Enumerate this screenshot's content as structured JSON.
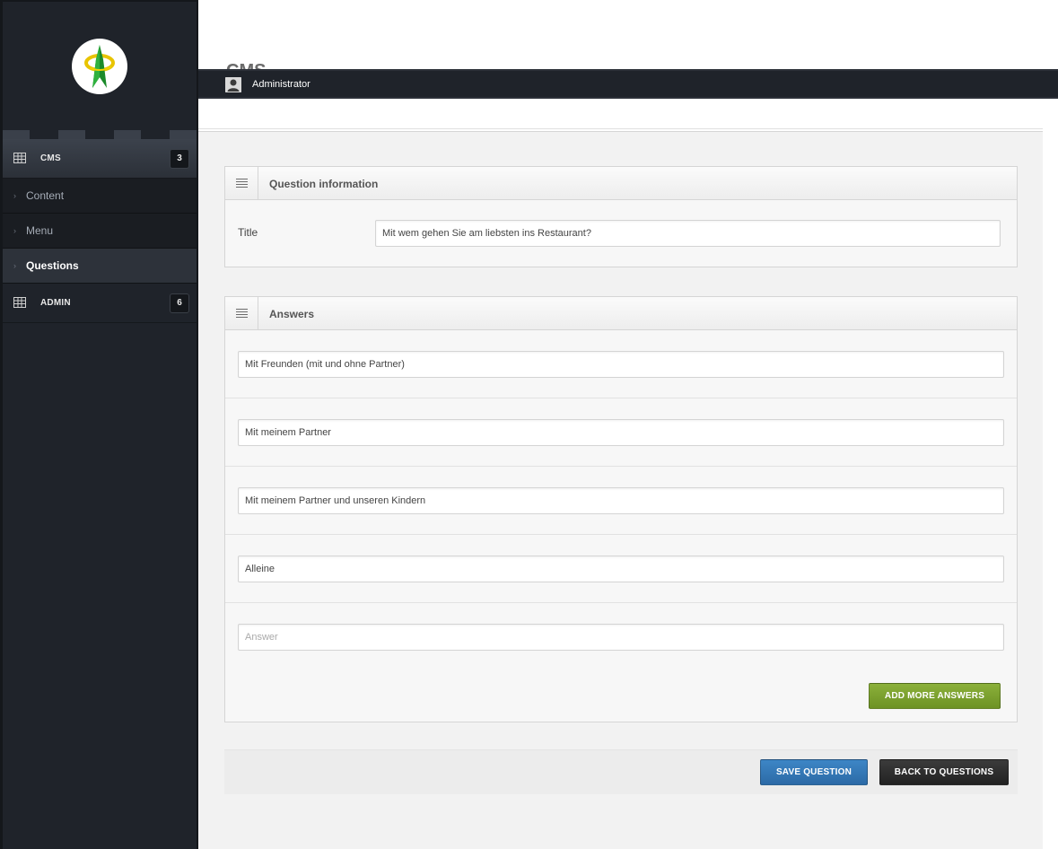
{
  "sidebar": {
    "logo": "anchor-emblem-logo",
    "sections": [
      {
        "label": "CMS",
        "badge": "3",
        "icon": "table-icon"
      },
      {
        "label": "ADMIN",
        "badge": "6",
        "icon": "table-icon"
      }
    ],
    "cms_items": [
      {
        "label": "Content"
      },
      {
        "label": "Menu"
      },
      {
        "label": "Questions"
      }
    ]
  },
  "header": {
    "page_title": "CMS",
    "user_name": "Administrator",
    "user_icon": "user-icon"
  },
  "question_info": {
    "title": "Question information",
    "title_label": "Title",
    "title_value": "Mit wem gehen Sie am liebsten ins Restaurant?"
  },
  "answers": {
    "title": "Answers",
    "items": [
      "Mit Freunden (mit und ohne Partner)",
      "Mit meinem Partner",
      "Mit meinem Partner und unseren Kindern",
      "Alleine"
    ],
    "empty_placeholder": "Answer",
    "add_more_label": "ADD MORE ANSWERS"
  },
  "actions": {
    "save_label": "SAVE QUESTION",
    "back_label": "BACK TO QUESTIONS"
  },
  "colors": {
    "sidebar_bg": "#1f232a",
    "green_button": "#7aa12e",
    "blue_button": "#3379b8",
    "dark_button": "#2e2e2e"
  }
}
